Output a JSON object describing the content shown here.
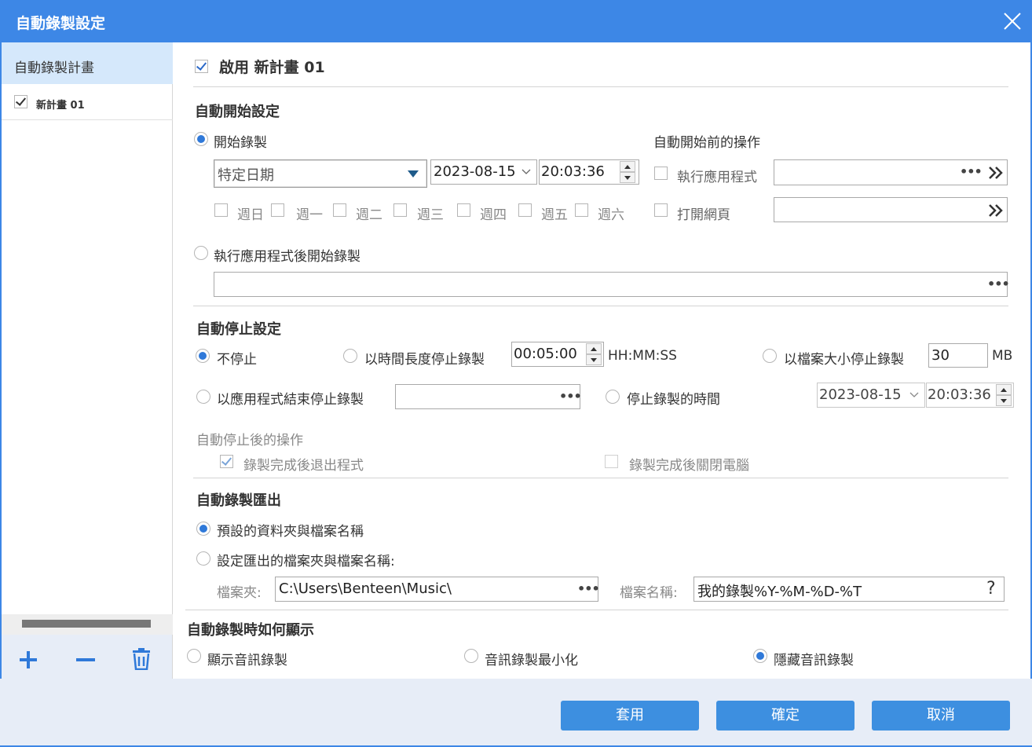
{
  "window": {
    "title": "自動錄製設定"
  },
  "sidebar": {
    "header": "自動錄製計畫",
    "plans": [
      {
        "label": "新計畫 01",
        "checked": true
      }
    ]
  },
  "plan": {
    "enable_label": "啟用 新計畫 01"
  },
  "auto_start": {
    "title": "自動開始設定",
    "start_recording_label": "開始錄製",
    "mode_select": "特定日期",
    "date": "2023-08-15",
    "time": "20:03:36",
    "weekdays": [
      "週日",
      "週一",
      "週二",
      "週三",
      "週四",
      "週五",
      "週六"
    ],
    "after_app_label": "執行應用程式後開始錄製",
    "pre_actions_title": "自動開始前的操作",
    "run_app_label": "執行應用程式",
    "open_web_label": "打開網頁"
  },
  "auto_stop": {
    "title": "自動停止設定",
    "no_stop_label": "不停止",
    "duration_label": "以時間長度停止錄製",
    "duration_value": "00:05:00",
    "duration_unit": "HH:MM:SS",
    "size_label": "以檔案大小停止錄製",
    "size_value": "30",
    "size_unit": "MB",
    "app_end_label": "以應用程式結束停止錄製",
    "stop_time_label": "停止錄製的時間",
    "stop_date": "2023-08-15",
    "stop_time": "20:03:36",
    "after_stop_title": "自動停止後的操作",
    "exit_app_label": "錄製完成後退出程式",
    "shutdown_label": "錄製完成後關閉電腦"
  },
  "export": {
    "title": "自動錄製匯出",
    "default_label": "預設的資料夾與檔案名稱",
    "custom_label": "設定匯出的檔案夾與檔案名稱:",
    "folder_label": "檔案夾:",
    "folder_value": "C:\\Users\\Benteen\\Music\\",
    "filename_label": "檔案名稱:",
    "filename_value": "我的錄製%Y-%M-%D-%T"
  },
  "display": {
    "title": "自動錄製時如何顯示",
    "show_label": "顯示音訊錄製",
    "minimize_label": "音訊錄製最小化",
    "hide_label": "隱藏音訊錄製"
  },
  "footer": {
    "apply": "套用",
    "ok": "確定",
    "cancel": "取消"
  },
  "colors": {
    "accent": "#3d87e6",
    "button": "#3d8fe0",
    "selected_row": "#d5e8fb"
  }
}
